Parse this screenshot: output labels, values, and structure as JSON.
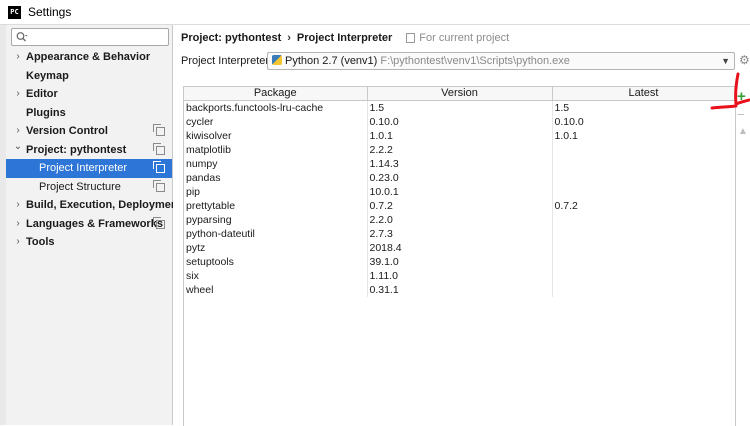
{
  "window": {
    "title": "Settings",
    "app_icon_text": "PC"
  },
  "search": {
    "placeholder": "Q▾"
  },
  "sidebar": {
    "items": [
      {
        "label": "Appearance & Behavior",
        "expander": "collapsed",
        "has_copy_icon": false
      },
      {
        "label": "Keymap",
        "expander": "none",
        "has_copy_icon": false
      },
      {
        "label": "Editor",
        "expander": "collapsed",
        "has_copy_icon": false
      },
      {
        "label": "Plugins",
        "expander": "none",
        "has_copy_icon": false
      },
      {
        "label": "Version Control",
        "expander": "collapsed",
        "has_copy_icon": true
      },
      {
        "label": "Project: pythontest",
        "expander": "expanded",
        "has_copy_icon": true
      },
      {
        "label": "Project Interpreter",
        "expander": "none",
        "has_copy_icon": true,
        "selected": true,
        "child": true
      },
      {
        "label": "Project Structure",
        "expander": "none",
        "has_copy_icon": true,
        "child": true
      },
      {
        "label": "Build, Execution, Deployment",
        "expander": "collapsed",
        "has_copy_icon": false
      },
      {
        "label": "Languages & Frameworks",
        "expander": "collapsed",
        "has_copy_icon": true
      },
      {
        "label": "Tools",
        "expander": "collapsed",
        "has_copy_icon": false
      }
    ]
  },
  "breadcrumb": {
    "project": "Project: pythontest",
    "separator": "›",
    "page": "Project Interpreter",
    "scope": "For current project"
  },
  "interpreter": {
    "label": "Project Interpreter:",
    "name": "Python 2.7 (venv1)",
    "path": "F:\\pythontest\\venv1\\Scripts\\python.exe"
  },
  "table": {
    "headers": [
      "Package",
      "Version",
      "Latest"
    ],
    "rows": [
      [
        "backports.functools-lru-cache",
        "1.5",
        "1.5"
      ],
      [
        "cycler",
        "0.10.0",
        "0.10.0"
      ],
      [
        "kiwisolver",
        "1.0.1",
        "1.0.1"
      ],
      [
        "matplotlib",
        "2.2.2",
        ""
      ],
      [
        "numpy",
        "1.14.3",
        ""
      ],
      [
        "pandas",
        "0.23.0",
        ""
      ],
      [
        "pip",
        "10.0.1",
        ""
      ],
      [
        "prettytable",
        "0.7.2",
        "0.7.2"
      ],
      [
        "pyparsing",
        "2.2.0",
        ""
      ],
      [
        "python-dateutil",
        "2.7.3",
        ""
      ],
      [
        "pytz",
        "2018.4",
        ""
      ],
      [
        "setuptools",
        "39.1.0",
        ""
      ],
      [
        "six",
        "1.11.0",
        ""
      ],
      [
        "wheel",
        "0.31.1",
        ""
      ]
    ]
  },
  "toolbar": {
    "add": "+",
    "remove": "−",
    "upgrade": "▲"
  },
  "colors": {
    "selection": "#2d75d6",
    "add_icon": "#3a9e3a",
    "annotation": "#e8101a"
  }
}
